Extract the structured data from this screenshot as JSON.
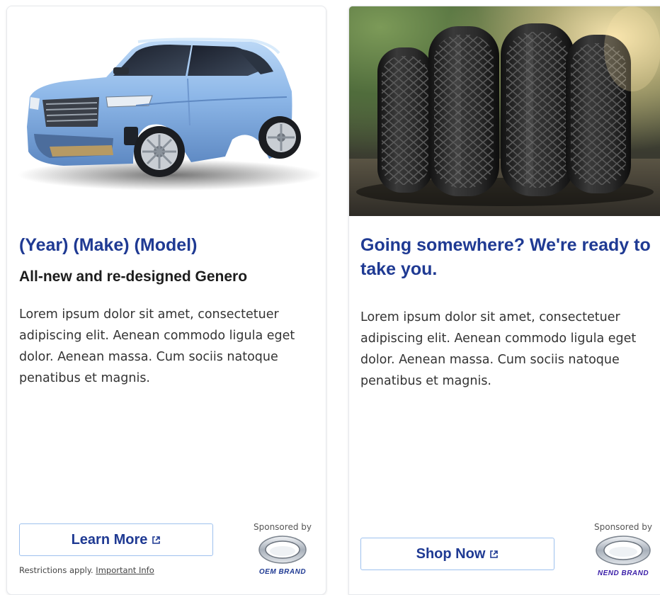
{
  "cards": [
    {
      "title": "(Year) (Make) (Model)",
      "subtitle": "All-new and re-designed Genero",
      "body": "Lorem ipsum dolor sit amet, consectetuer adipiscing elit. Aenean commodo ligula eget dolor. Aenean massa. Cum sociis natoque penatibus et magnis.",
      "cta_label": "Learn More",
      "restrictions_text": "Restrictions apply.",
      "important_info_link": "Important Info",
      "sponsor_label": "Sponsored by",
      "brand_name": "OEM BRAND",
      "brand_color": "#1f3a93"
    },
    {
      "title": "Going somewhere? We're ready to take you.",
      "body": "Lorem ipsum dolor sit amet, consectetuer adipiscing elit. Aenean commodo ligula eget dolor. Aenean massa. Cum sociis natoque penatibus et magnis.",
      "cta_label": "Shop Now",
      "sponsor_label": "Sponsored by",
      "brand_name": "NEND BRAND",
      "brand_color": "#3b1fa8"
    }
  ],
  "icons": {
    "cta_icon": "external-link-icon",
    "brand_logo": "oval-logo-icon"
  },
  "colors": {
    "title": "#1f3a93",
    "cta_border": "#9ec1ee"
  }
}
